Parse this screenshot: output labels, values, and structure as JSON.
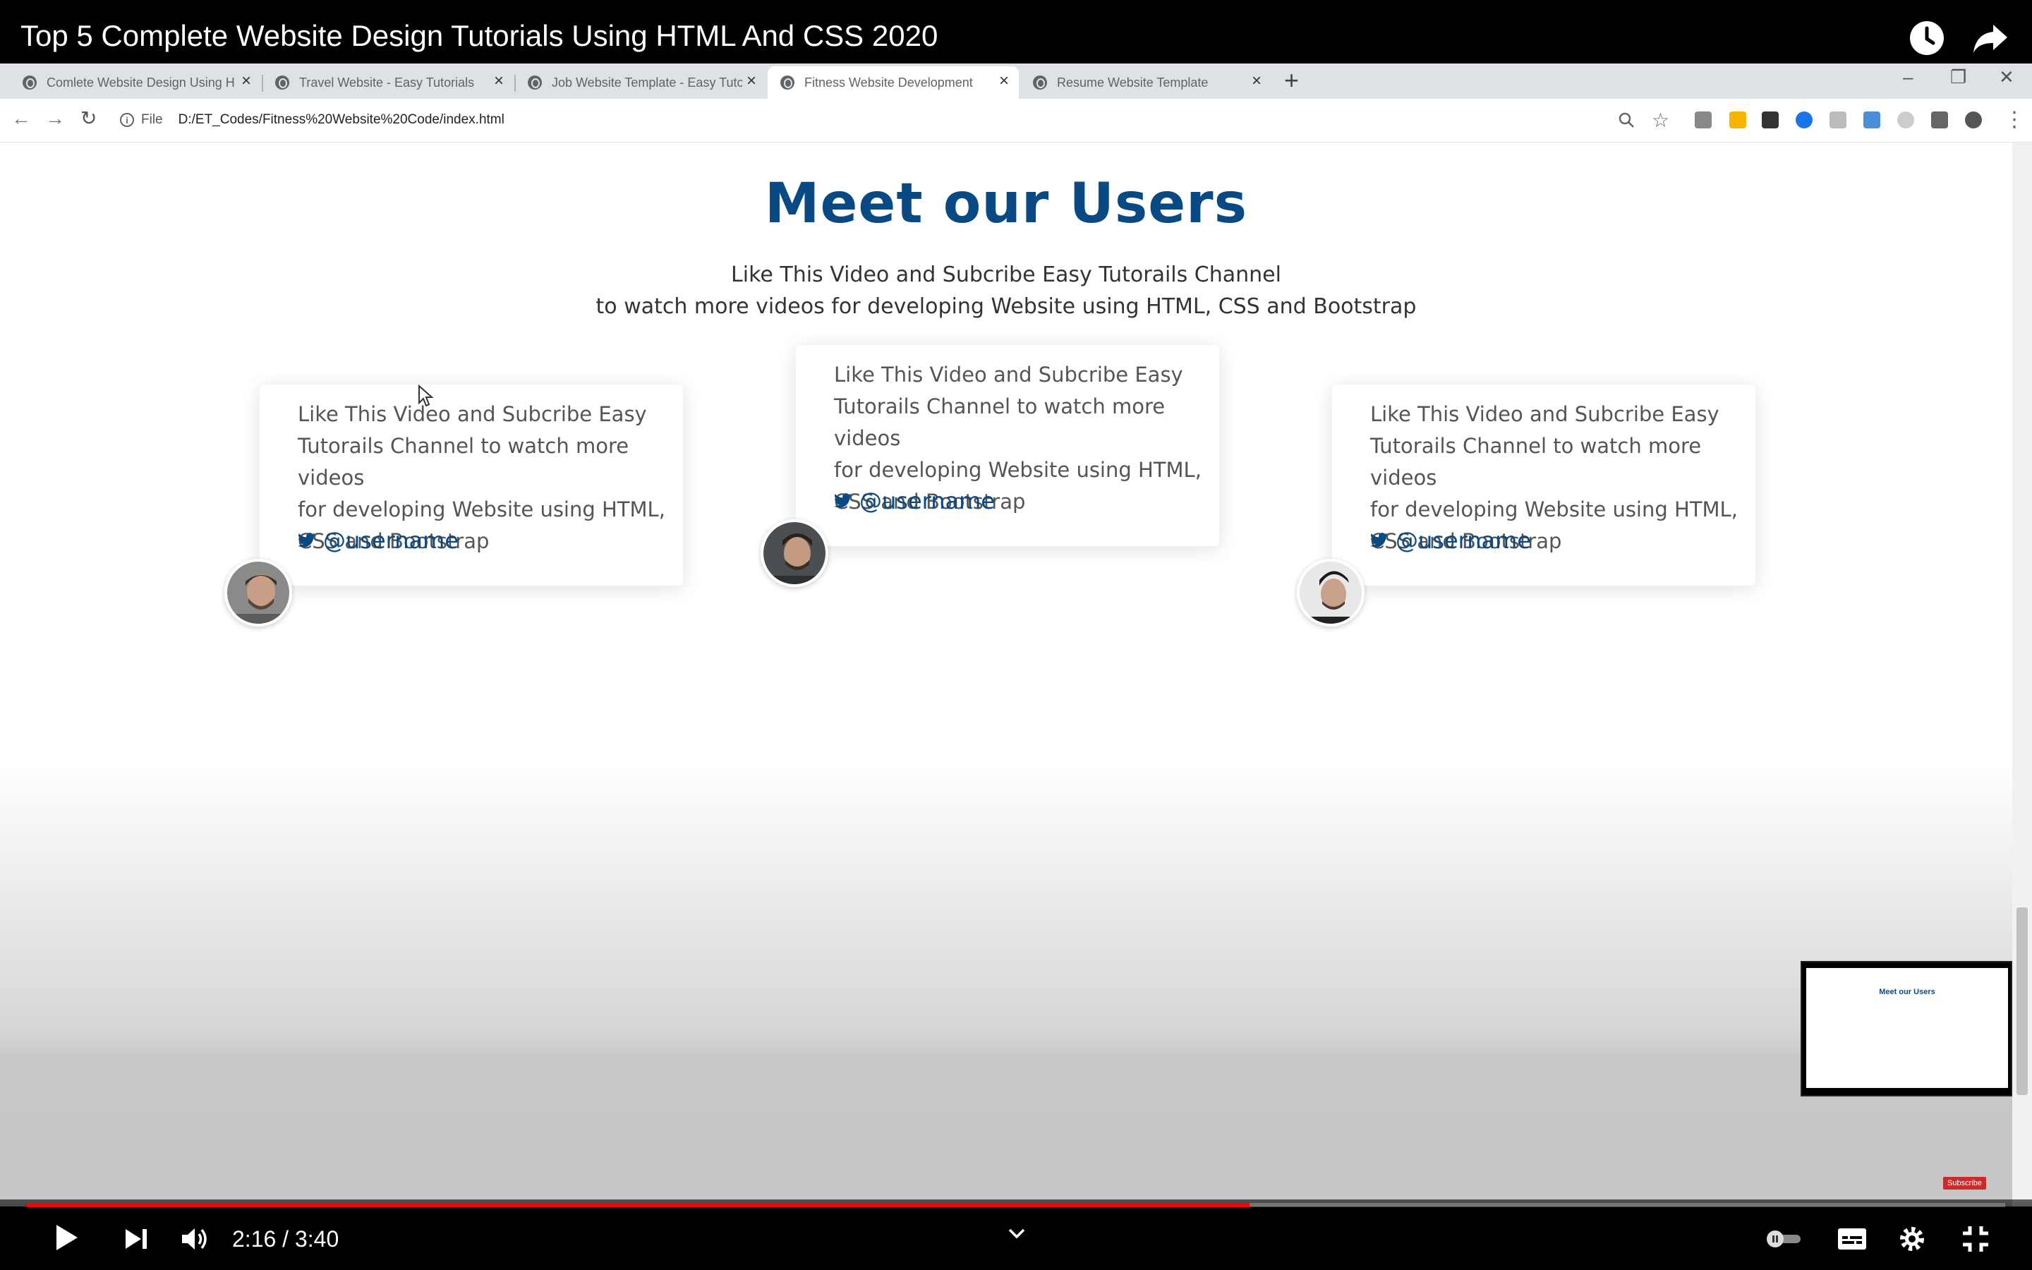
{
  "video": {
    "title": "Top 5 Complete Website Design Tutorials Using HTML And CSS 2020",
    "current_time": "2:16",
    "duration": "3:40",
    "time_display": "2:16 / 3:40",
    "progress_fraction": 0.618
  },
  "browser": {
    "tabs": [
      {
        "label": "Comlete Website Design Using H"
      },
      {
        "label": "Travel Website - Easy Tutorials"
      },
      {
        "label": "Job Website Template - Easy Tuto"
      },
      {
        "label": "Fitness Website Development"
      },
      {
        "label": "Resume Website Template"
      }
    ],
    "active_tab": 3,
    "file_label": "File",
    "url": "D:/ET_Codes/Fitness%20Website%20Code/index.html"
  },
  "page": {
    "title": "Meet our Users",
    "subtitle_line1": "Like This Video and Subcribe Easy Tutorails Channel",
    "subtitle_line2": "to watch more videos for developing Website using HTML, CSS and Bootstrap",
    "testimonials": [
      {
        "lines": [
          "Like This Video and Subcribe Easy",
          "Tutorails Channel to watch more videos",
          "for developing Website using HTML,",
          "CSS and Bootstrap"
        ],
        "handle": "@username"
      },
      {
        "lines": [
          "Like This Video and Subcribe Easy",
          "Tutorails Channel to watch more videos",
          "for developing Website using HTML,",
          "CSS and Bootstrap"
        ],
        "handle": "@username"
      },
      {
        "lines": [
          "Like This Video and Subcribe Easy",
          "Tutorails Channel to watch more videos",
          "for developing Website using HTML,",
          "CSS and Bootstrap"
        ],
        "handle": "@username"
      }
    ]
  },
  "preview": {
    "title": "Meet our Users"
  },
  "subscribe_label": "Subscribe",
  "colors": {
    "accent": "#0a4a84",
    "progress": "#ff0000"
  }
}
